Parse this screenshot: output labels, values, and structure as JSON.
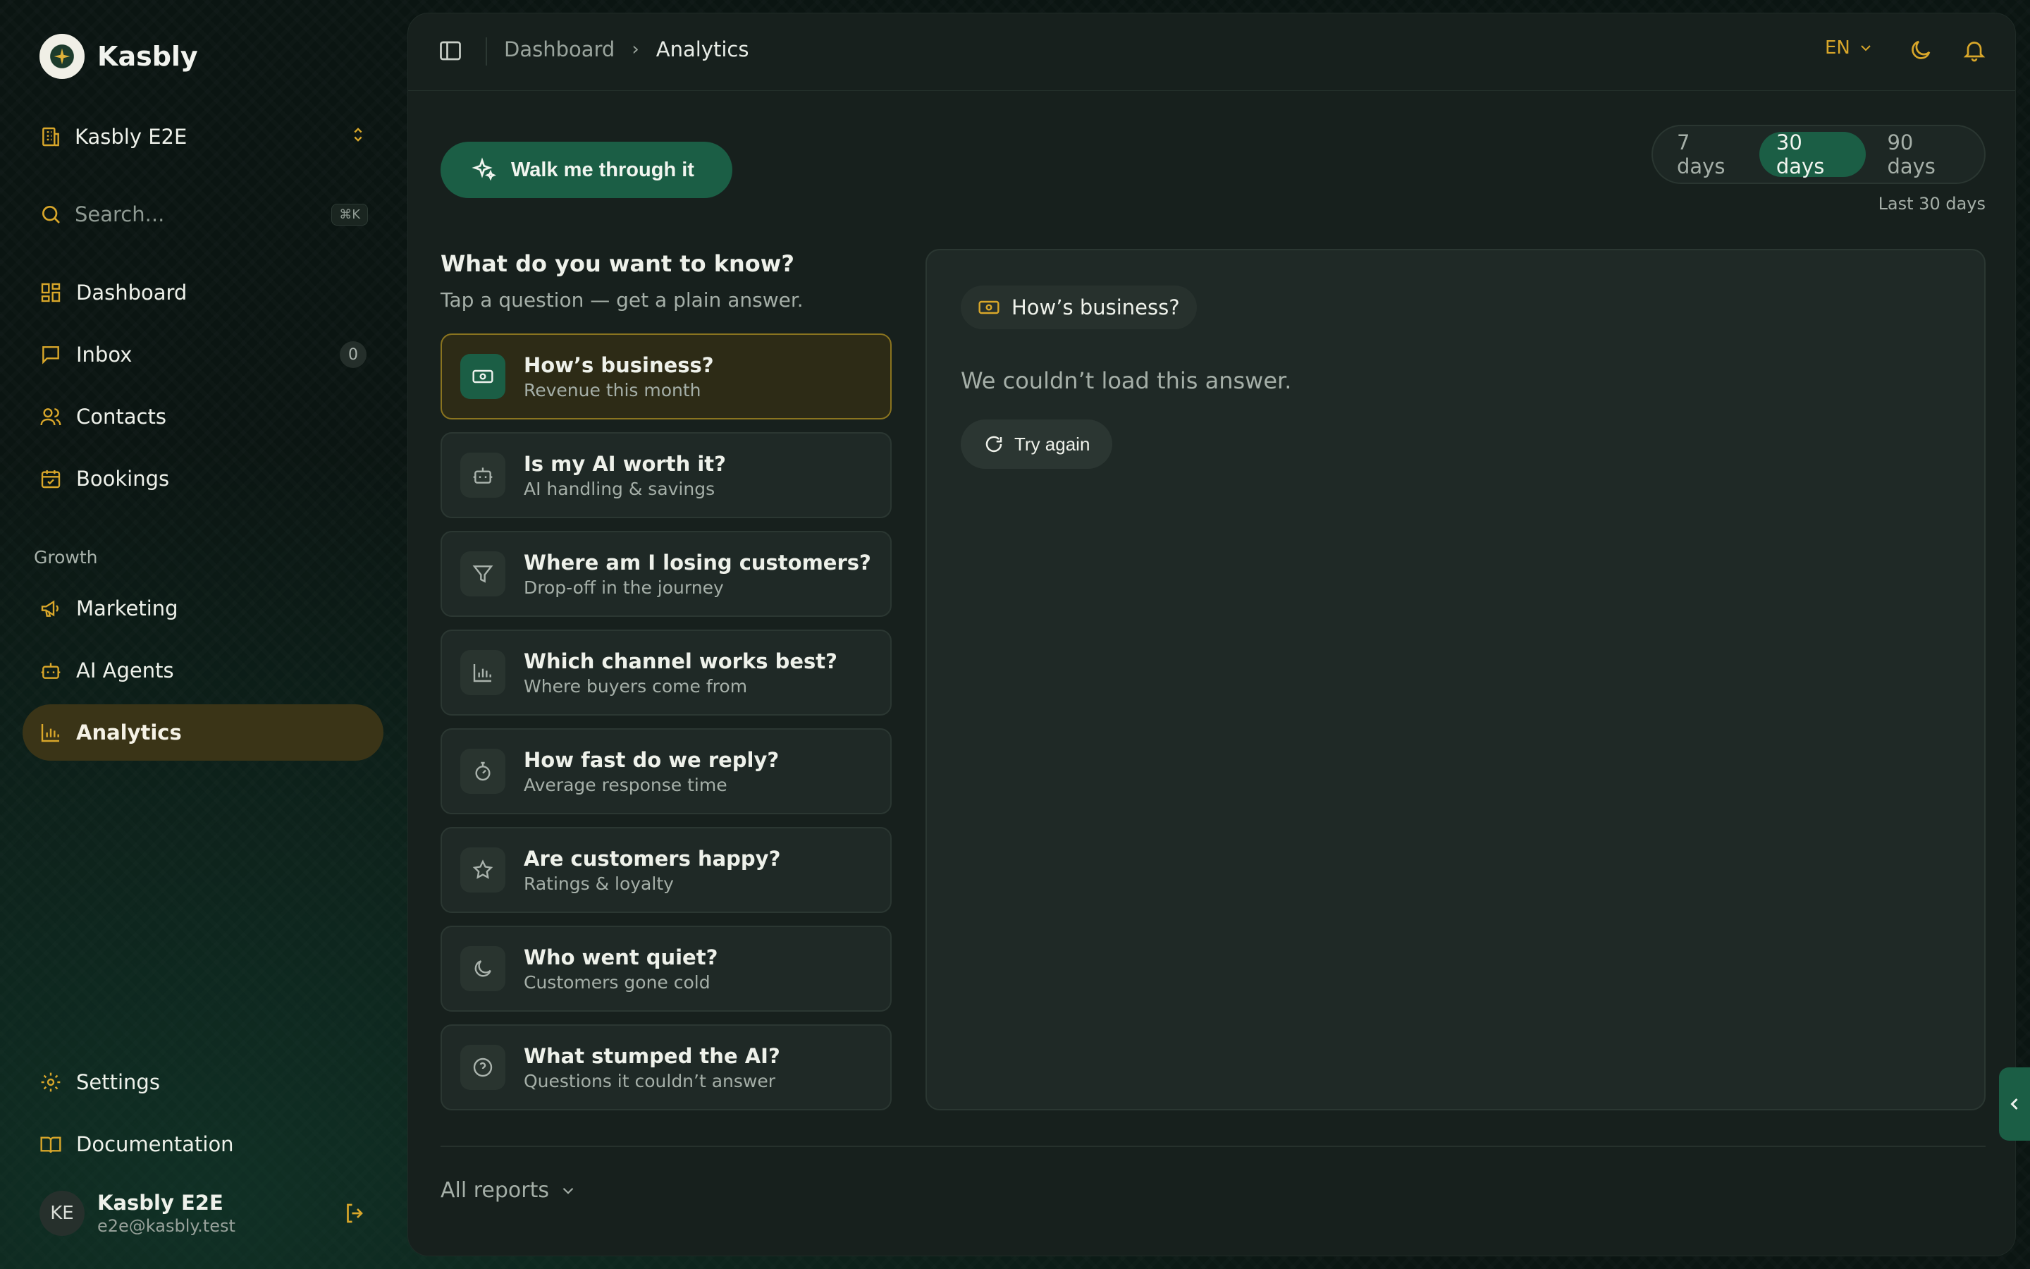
{
  "brand": {
    "name": "Kasbly"
  },
  "workspace": {
    "name": "Kasbly E2E"
  },
  "search": {
    "placeholder": "Search...",
    "shortcut": "⌘K"
  },
  "nav": {
    "main": [
      {
        "label": "Dashboard",
        "icon": "dashboard-icon"
      },
      {
        "label": "Inbox",
        "icon": "inbox-icon",
        "count": "0"
      },
      {
        "label": "Contacts",
        "icon": "contacts-icon"
      },
      {
        "label": "Bookings",
        "icon": "calendar-icon"
      }
    ],
    "growth_label": "Growth",
    "growth": [
      {
        "label": "Marketing",
        "icon": "megaphone-icon"
      },
      {
        "label": "AI Agents",
        "icon": "bot-icon"
      },
      {
        "label": "Analytics",
        "icon": "bar-chart-icon",
        "active": true
      }
    ],
    "bottom": [
      {
        "label": "Settings",
        "icon": "gear-icon"
      },
      {
        "label": "Documentation",
        "icon": "book-icon"
      }
    ]
  },
  "user": {
    "initials": "KE",
    "name": "Kasbly E2E",
    "email": "e2e@kasbly.test"
  },
  "topbar": {
    "breadcrumb": [
      "Dashboard",
      "Analytics"
    ],
    "language": "EN"
  },
  "walkthrough": {
    "label": "Walk me through it"
  },
  "range": {
    "options": [
      "7 days",
      "30 days",
      "90 days"
    ],
    "selected": "30 days",
    "caption": "Last 30 days"
  },
  "questions": {
    "title": "What do you want to know?",
    "subtitle": "Tap a question — get a plain answer.",
    "items": [
      {
        "label": "How’s business?",
        "desc": "Revenue this month",
        "icon": "cash-icon",
        "active": true
      },
      {
        "label": "Is my AI worth it?",
        "desc": "AI handling & savings",
        "icon": "bot-icon"
      },
      {
        "label": "Where am I losing customers?",
        "desc": "Drop-off in the journey",
        "icon": "funnel-icon"
      },
      {
        "label": "Which channel works best?",
        "desc": "Where buyers come from",
        "icon": "bar-chart-icon"
      },
      {
        "label": "How fast do we reply?",
        "desc": "Average response time",
        "icon": "stopwatch-icon"
      },
      {
        "label": "Are customers happy?",
        "desc": "Ratings & loyalty",
        "icon": "star-icon"
      },
      {
        "label": "Who went quiet?",
        "desc": "Customers gone cold",
        "icon": "moon-icon"
      },
      {
        "label": "What stumped the AI?",
        "desc": "Questions it couldn’t answer",
        "icon": "question-icon"
      }
    ]
  },
  "answer": {
    "chip": "How’s business?",
    "error": "We couldn’t load this answer.",
    "retry": "Try again"
  },
  "footer": {
    "all_reports": "All reports"
  },
  "colors": {
    "accent": "#d9a72a",
    "primary": "#1b5e45",
    "panel": "#17201d"
  }
}
